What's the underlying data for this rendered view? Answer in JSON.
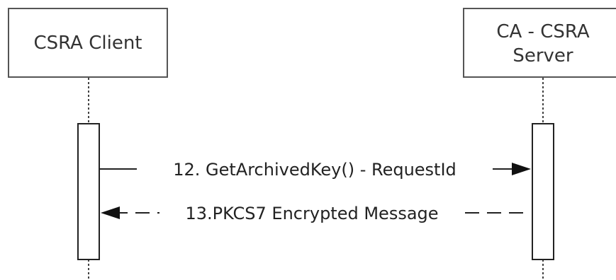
{
  "participants": [
    {
      "id": "client",
      "lines": [
        "CSRA Client"
      ]
    },
    {
      "id": "server",
      "lines": [
        "CA - CSRA",
        "Server"
      ]
    }
  ],
  "messages": [
    {
      "id": "msg12",
      "label": "12. GetArchivedKey() - RequestId",
      "from": "client",
      "to": "server",
      "style": "solid"
    },
    {
      "id": "msg13",
      "label": "13.PKCS7 Encrypted Message",
      "from": "server",
      "to": "client",
      "style": "dashed"
    }
  ]
}
